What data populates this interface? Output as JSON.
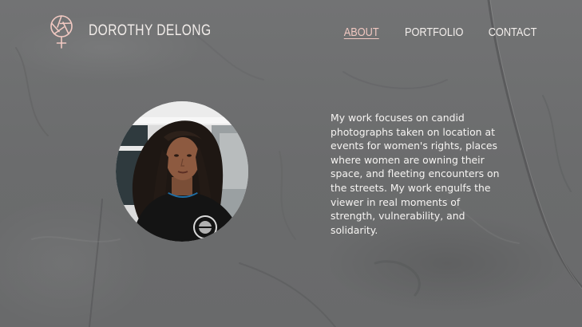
{
  "header": {
    "logo_icon": "female-symbol-aperture-icon",
    "brand_name": "DOROTHY DELONG",
    "accent_color": "#f0c7c0"
  },
  "nav": {
    "items": [
      {
        "label": "ABOUT",
        "active": true
      },
      {
        "label": "PORTFOLIO",
        "active": false
      },
      {
        "label": "CONTACT",
        "active": false
      }
    ]
  },
  "main": {
    "portrait": "portrait-photo",
    "bio": "My work focuses on candid photographs taken on location at events for women's rights, places where women are owning their space, and fleeting encounters on the streets. My work engulfs the viewer in real moments of strength, vulnerability, and solidarity."
  },
  "colors": {
    "background": "#6d6e6f",
    "text": "#f6f4f2"
  }
}
